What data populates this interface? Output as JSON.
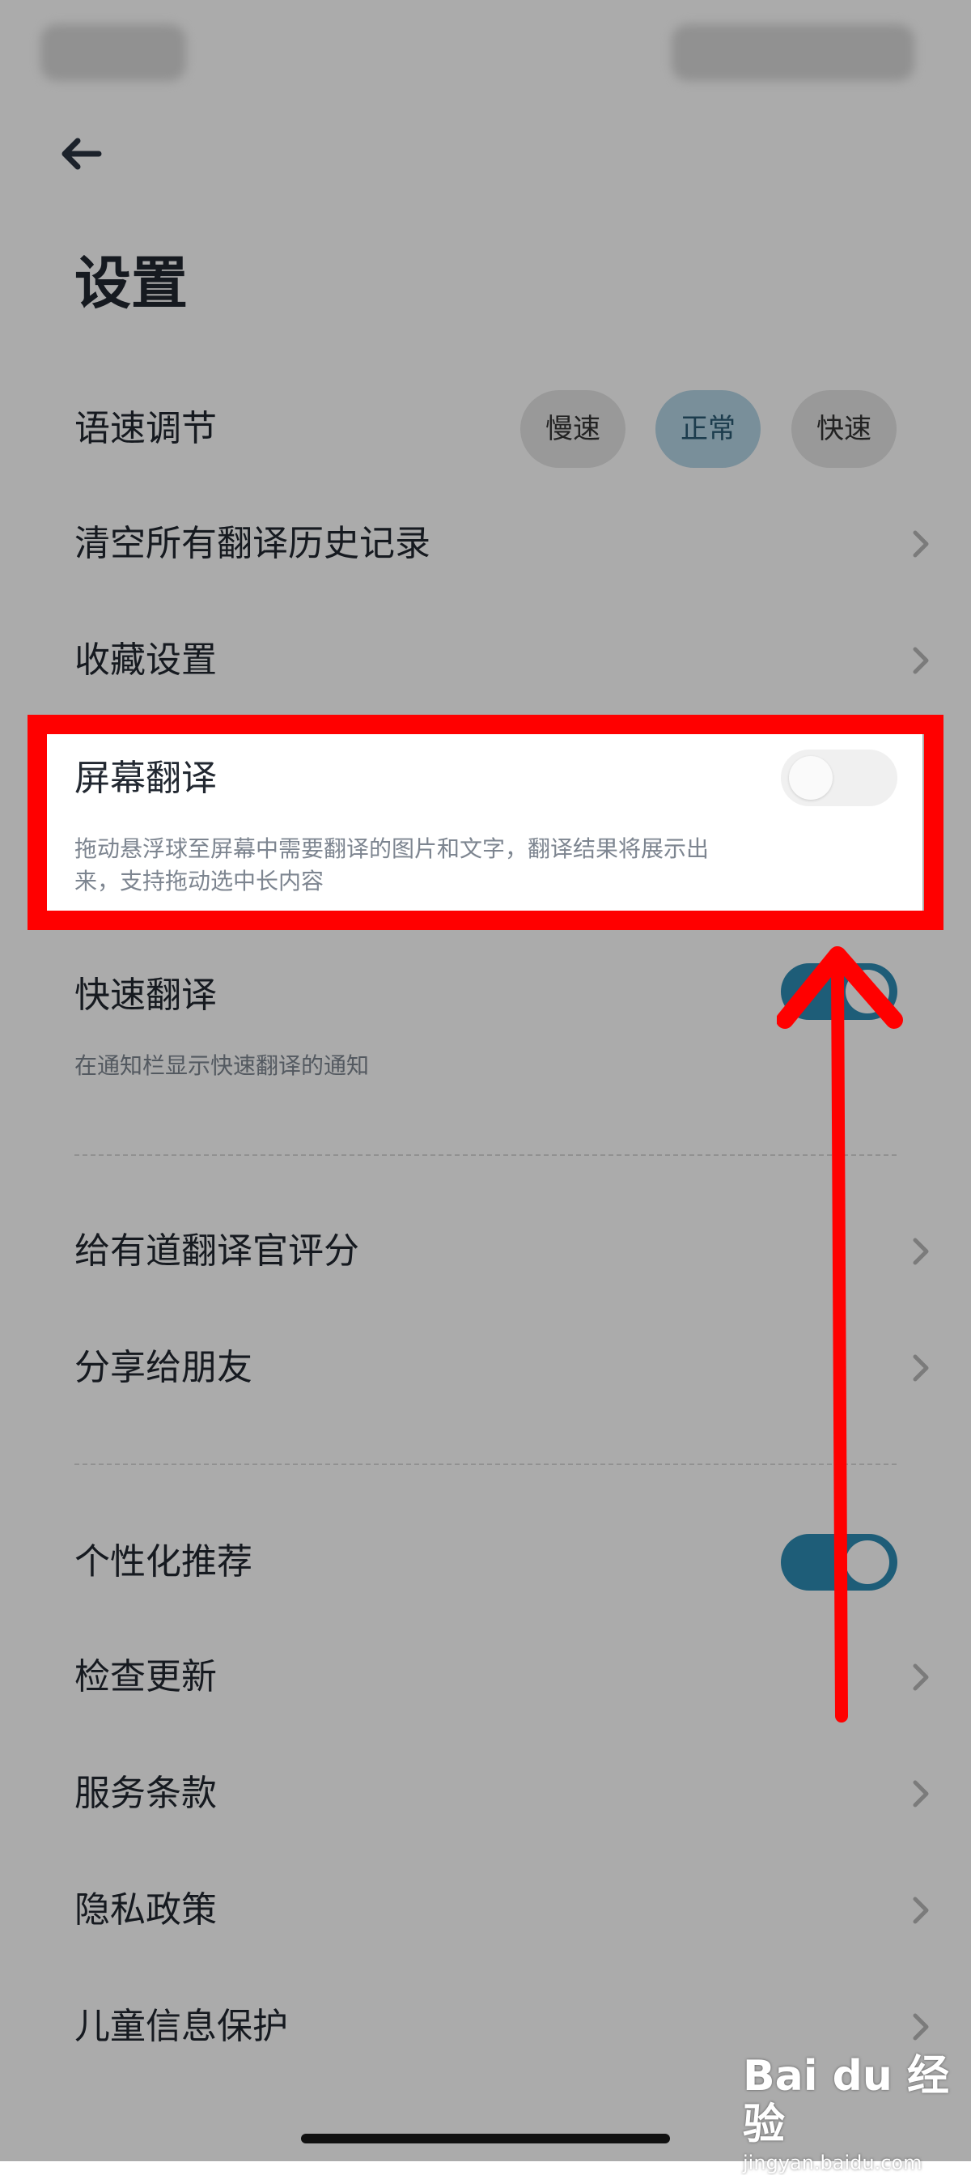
{
  "page": {
    "title": "设置"
  },
  "icons": {
    "back": "back-arrow-icon",
    "chevron": "chevron-right-icon"
  },
  "speech_rate": {
    "label": "语速调节",
    "options": [
      "慢速",
      "正常",
      "快速"
    ],
    "selected": "正常"
  },
  "rows": {
    "clear_history": "清空所有翻译历史记录",
    "favorites": "收藏设置",
    "screen_translate": {
      "label": "屏幕翻译",
      "desc_line1": "拖动悬浮球至屏幕中需要翻译的图片和文字，翻译结果将展示出",
      "desc_line2": "来，支持拖动选中长内容",
      "enabled": false
    },
    "quick_translate": {
      "label": "快速翻译",
      "desc": "在通知栏显示快速翻译的通知",
      "enabled": true
    },
    "rate_app": "给有道翻译官评分",
    "share": "分享给朋友",
    "personalized": {
      "label": "个性化推荐",
      "enabled": true
    },
    "check_update": "检查更新",
    "terms": "服务条款",
    "privacy": "隐私政策",
    "child_privacy": "儿童信息保护"
  },
  "watermark": {
    "logo": "Bai du 经验",
    "url": "jingyan.baidu.com"
  },
  "colors": {
    "accent": "#2e8bb3",
    "selected_chip": "#b5d6e6",
    "annotation_red": "#ff0000"
  }
}
